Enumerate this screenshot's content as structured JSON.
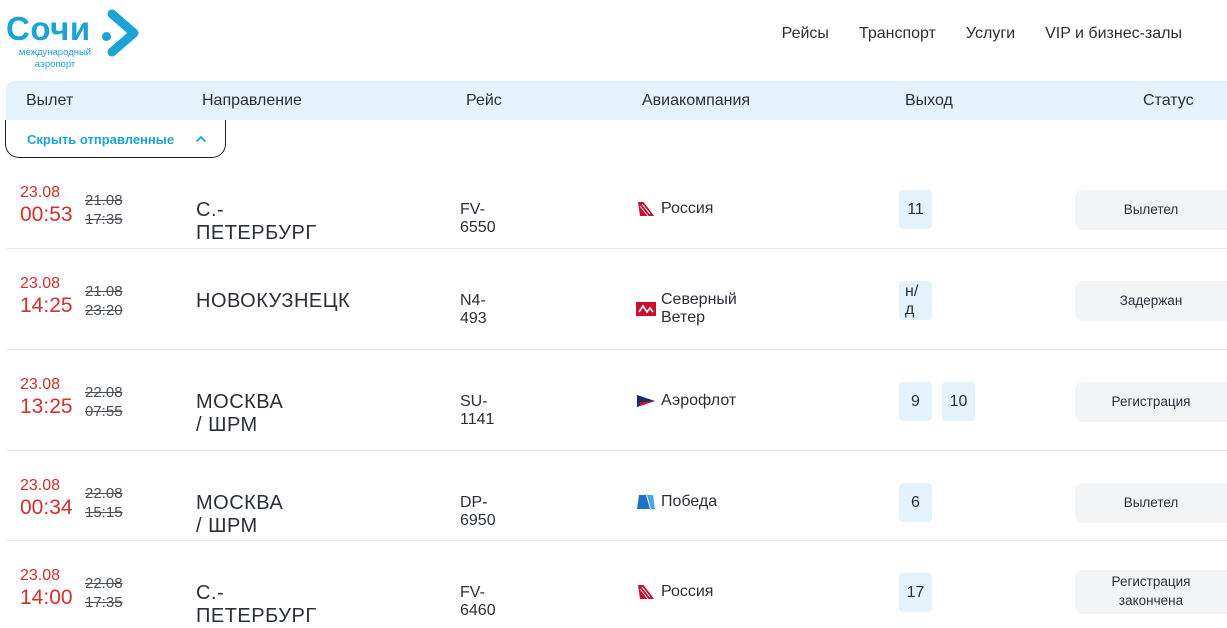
{
  "logo": {
    "word": "Сочи",
    "subtitle_line1": "международный",
    "subtitle_line2": "аэропорт"
  },
  "nav": [
    "Рейсы",
    "Транспорт",
    "Услуги",
    "VIP и бизнес-залы"
  ],
  "columns": {
    "departure": "Вылет",
    "direction": "Направление",
    "flight": "Рейс",
    "airline": "Авиакомпания",
    "gate": "Выход",
    "status": "Статус"
  },
  "hide_departed": {
    "label": "Скрыть отправленные",
    "icon": "chevron-up-icon"
  },
  "flights": [
    {
      "new_date": "23.08",
      "new_time": "00:53",
      "old_date": "21.08",
      "old_time": "17:35",
      "destination": "С.-ПЕТЕРБУРГ",
      "flight": "FV-6550",
      "airline": "Россия",
      "airline_logo": "rossiya-logo",
      "gates": [
        "11"
      ],
      "status": "Вылетел"
    },
    {
      "new_date": "23.08",
      "new_time": "14:25",
      "old_date": "21.08",
      "old_time": "23:20",
      "destination": "НОВОКУЗНЕЦК",
      "flight": "N4-493",
      "airline": "Северный Ветер",
      "airline_logo": "nordwind-logo",
      "gates": [
        "н/д"
      ],
      "status": "Задержан"
    },
    {
      "new_date": "23.08",
      "new_time": "13:25",
      "old_date": "22.08",
      "old_time": "07:55",
      "destination": "МОСКВА / ШРМ",
      "flight": "SU-1141",
      "airline": "Аэрофлот",
      "airline_logo": "aeroflot-logo",
      "gates": [
        "9",
        "10"
      ],
      "status": "Регистрация"
    },
    {
      "new_date": "23.08",
      "new_time": "00:34",
      "old_date": "22.08",
      "old_time": "15:15",
      "destination": "МОСКВА / ШРМ",
      "flight": "DP-6950",
      "airline": "Победа",
      "airline_logo": "pobeda-logo",
      "gates": [
        "6"
      ],
      "status": "Вылетел"
    },
    {
      "new_date": "23.08",
      "new_time": "14:00",
      "old_date": "22.08",
      "old_time": "17:35",
      "destination": "С.-ПЕТЕРБУРГ",
      "flight": "FV-6460",
      "airline": "Россия",
      "airline_logo": "rossiya-logo",
      "gates": [
        "17"
      ],
      "status": "Регистрация закончена"
    }
  ]
}
